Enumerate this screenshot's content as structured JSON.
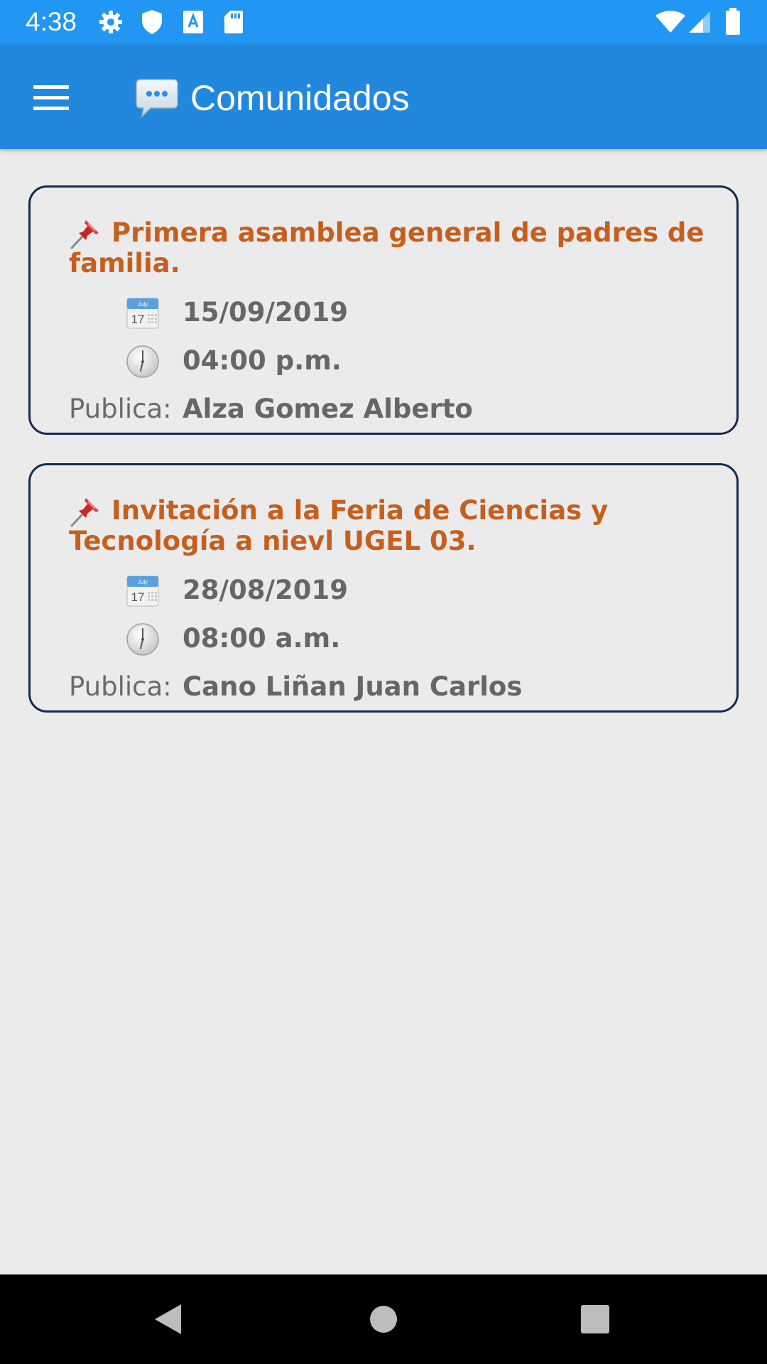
{
  "status_bar": {
    "time": "4:38",
    "icons": [
      "gear-icon",
      "shield-icon",
      "keyboard-a-icon",
      "sd-card-icon",
      "wifi-icon",
      "signal-icon",
      "battery-icon"
    ]
  },
  "app_bar": {
    "menu_icon": "hamburger-menu-icon",
    "title_icon": "speech-bubble-icon",
    "title": "Comunidados"
  },
  "colors": {
    "status_bar": "#2196f3",
    "app_bar": "#2188de",
    "card_border": "#152a4e",
    "title_text": "#c65f1e",
    "body_text": "#666666",
    "background": "#ebebec"
  },
  "announcements": [
    {
      "title": "Primera asamblea general de padres de familia.",
      "date": "15/09/2019",
      "time": "04:00 p.m.",
      "publisher_label": "Publica:",
      "publisher": "Alza Gomez Alberto"
    },
    {
      "title": "Invitación a la Feria de Ciencias y Tecnología a nievl UGEL 03.",
      "date": "28/08/2019",
      "time": "08:00 a.m.",
      "publisher_label": "Publica:",
      "publisher": "Cano Liñan Juan Carlos"
    }
  ],
  "nav_bar": {
    "buttons": [
      "back-icon",
      "home-icon",
      "recents-icon"
    ]
  }
}
